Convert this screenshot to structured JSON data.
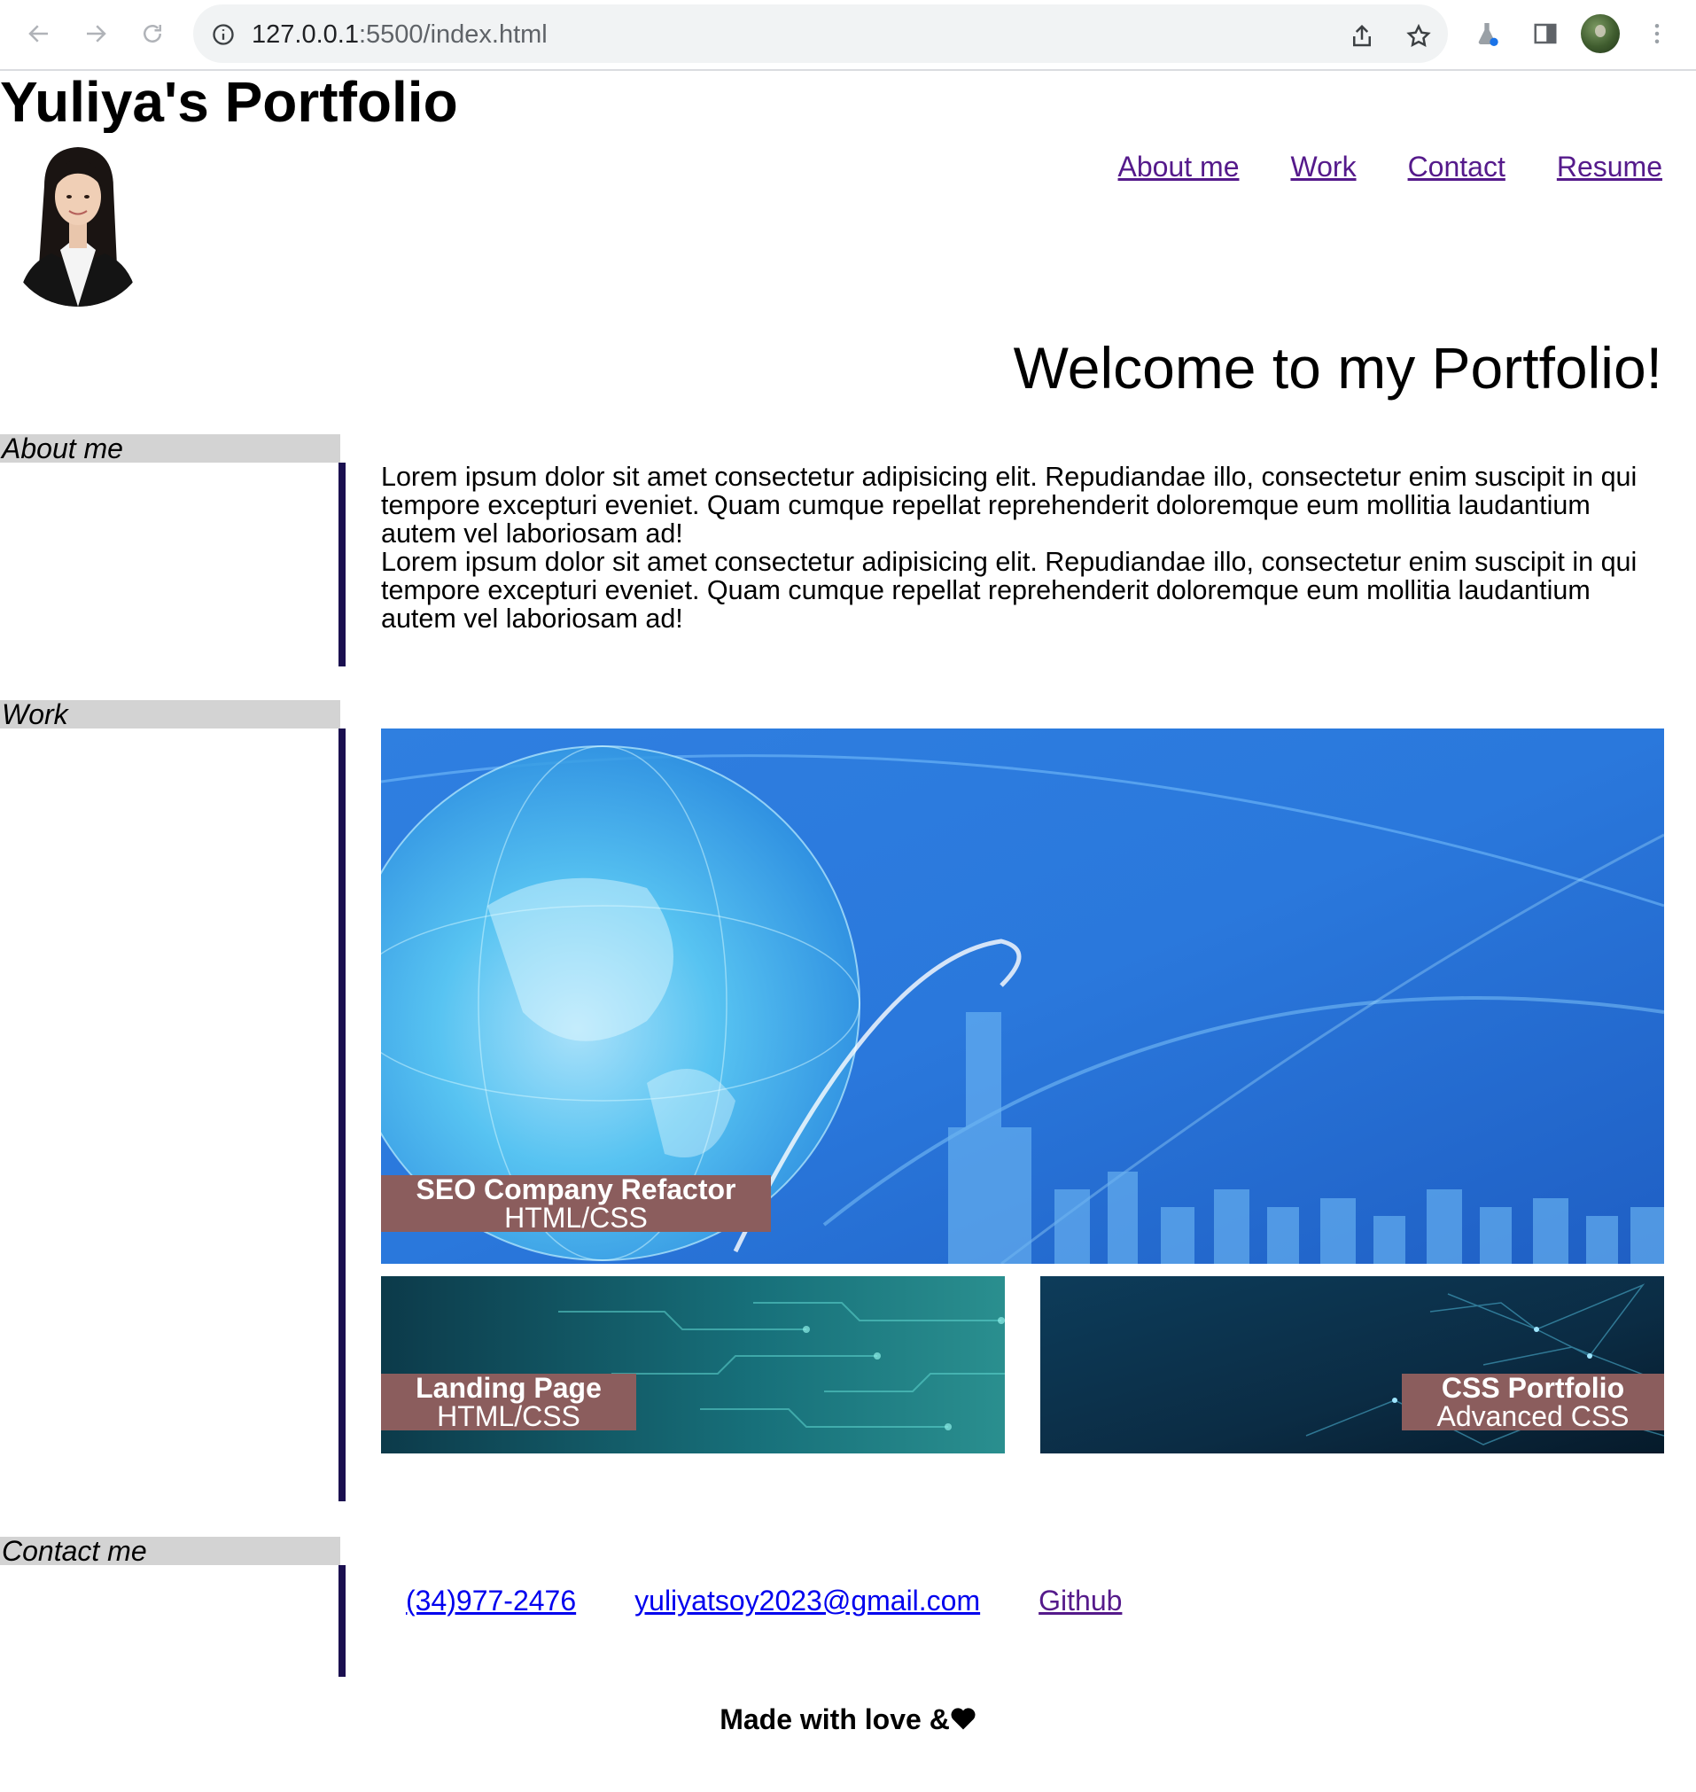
{
  "browser": {
    "url_host": "127.0.0.1",
    "url_path": ":5500/index.html"
  },
  "site": {
    "title": "Yuliya's Portfolio",
    "nav": [
      "About me",
      "Work",
      "Contact",
      "Resume"
    ],
    "welcome": "Welcome to my Portfolio!"
  },
  "about": {
    "heading": "About me",
    "paragraphs": [
      "Lorem ipsum dolor sit amet consectetur adipisicing elit. Repudiandae illo, consectetur enim suscipit in qui tempore excepturi eveniet. Quam cumque repellat reprehenderit doloremque eum mollitia laudantium autem vel laboriosam ad!",
      "Lorem ipsum dolor sit amet consectetur adipisicing elit. Repudiandae illo, consectetur enim suscipit in qui tempore excepturi eveniet. Quam cumque repellat reprehenderit doloremque eum mollitia laudantium autem vel laboriosam ad!"
    ]
  },
  "work": {
    "heading": "Work",
    "projects": [
      {
        "title": "SEO Company Refactor",
        "subtitle": "HTML/CSS"
      },
      {
        "title": "Landing Page",
        "subtitle": "HTML/CSS"
      },
      {
        "title": "CSS Portfolio",
        "subtitle": "Advanced CSS"
      }
    ]
  },
  "contact": {
    "heading": "Contact me",
    "phone": "(34)977-2476",
    "email": "yuliyatsoy2023@gmail.com",
    "github": "Github"
  },
  "footer": {
    "text": "Made with love &",
    "icon": "heart-icon"
  },
  "colors": {
    "accent_bar": "#1b1050",
    "section_tag_bg": "#d3d3d3",
    "project_label_bg": "#8b5d5d",
    "link_visited": "#551a8b",
    "link": "#0000ee"
  }
}
